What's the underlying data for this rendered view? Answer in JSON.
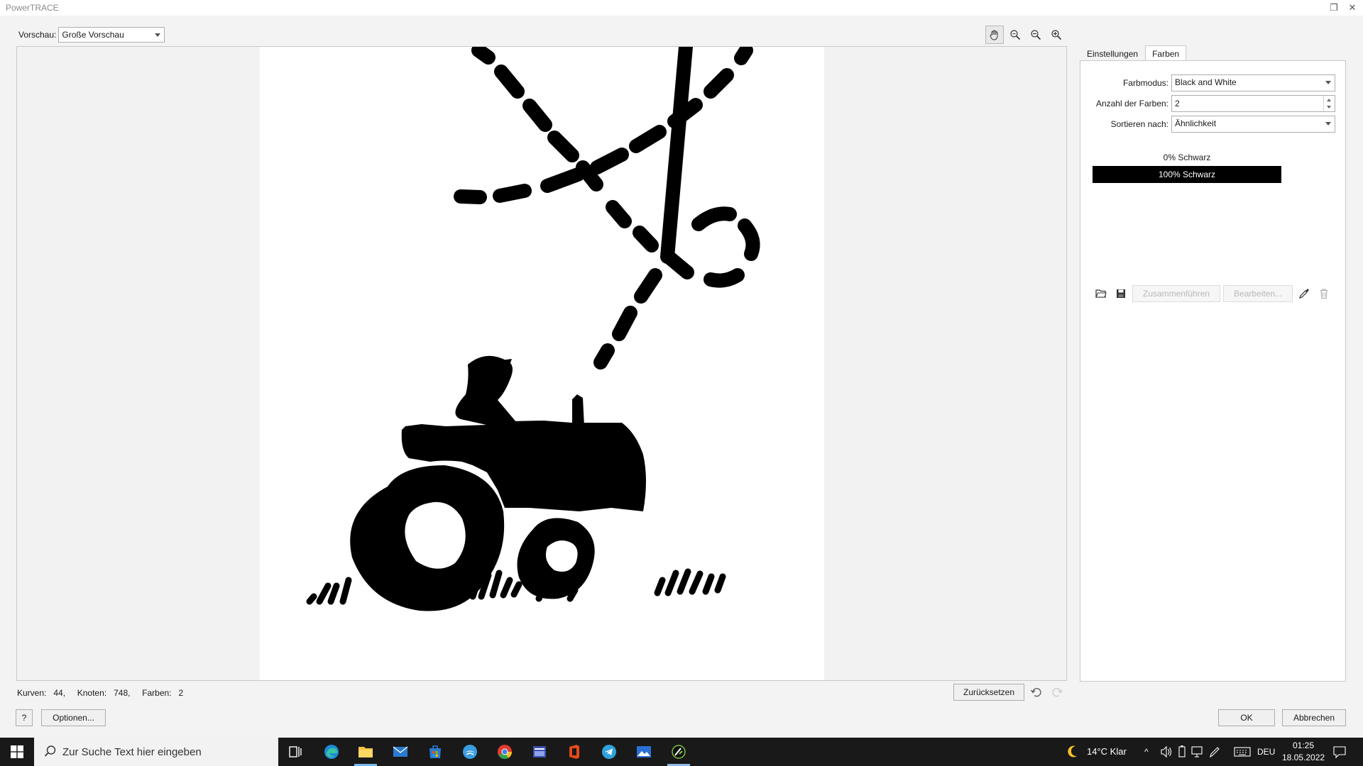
{
  "window": {
    "title": "PowerTRACE"
  },
  "preview": {
    "label": "Vorschau:",
    "selected": "Große Vorschau"
  },
  "tabs": [
    {
      "label": "Einstellungen"
    },
    {
      "label": "Farben"
    }
  ],
  "colors_panel": {
    "farbmodus_label": "Farbmodus:",
    "farbmodus_value": "Black and White",
    "anzahl_label": "Anzahl der Farben:",
    "anzahl_value": "2",
    "sortieren_label": "Sortieren nach:",
    "sortieren_value": "Ähnlichkeit",
    "color_items": [
      "0% Schwarz",
      "100% Schwarz"
    ],
    "merge_label": "Zusammenführen",
    "edit_label": "Bearbeiten..."
  },
  "status": {
    "kurven_label": "Kurven:",
    "kurven_value": "44,",
    "knoten_label": "Knoten:",
    "knoten_value": "748,",
    "farben_label": "Farben:",
    "farben_value": "2"
  },
  "buttons": {
    "reset": "Zurücksetzen",
    "help": "?",
    "options": "Optionen...",
    "ok": "OK",
    "cancel": "Abbrechen"
  },
  "taskbar": {
    "search_placeholder": "Zur Suche Text hier eingeben",
    "weather": "14°C  Klar",
    "language": "DEU",
    "time": "01:25",
    "date": "18.05.2022"
  },
  "colors": {
    "accent": "#76b9ed",
    "taskbar": "#191919",
    "selected_color": "#000000"
  }
}
